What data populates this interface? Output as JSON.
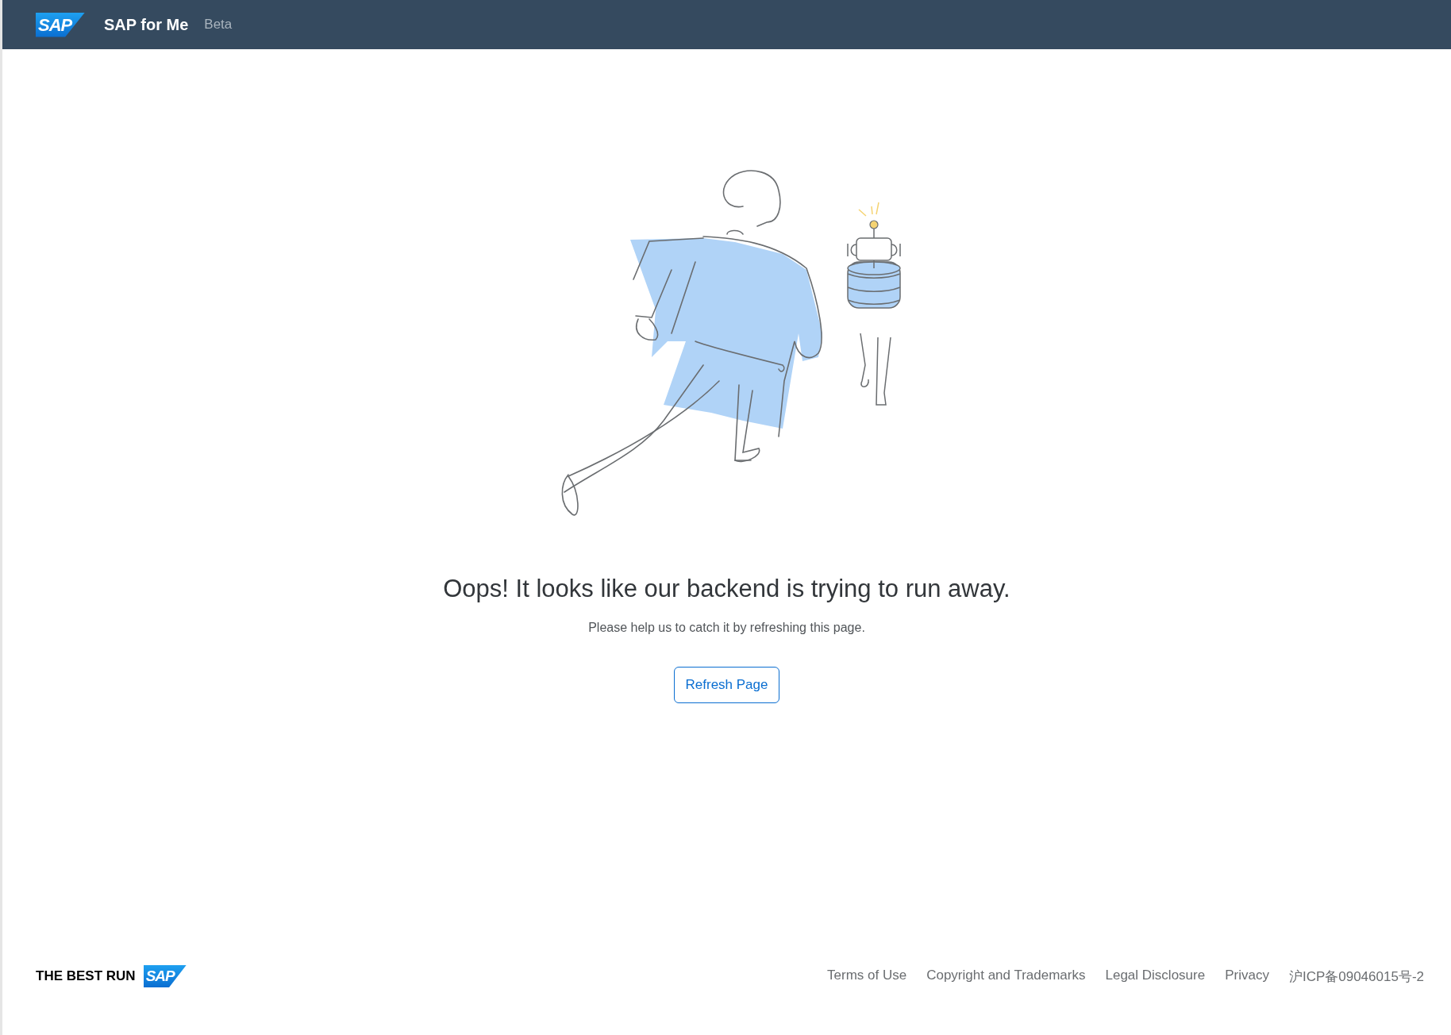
{
  "header": {
    "logo": "SAP",
    "title": "SAP for Me",
    "badge": "Beta"
  },
  "message": {
    "heading": "Oops! It looks like our backend is trying to run away.",
    "text": "Please help us to catch it by refreshing this page.",
    "button": "Refresh Page"
  },
  "footer": {
    "tagline": "THE BEST RUN",
    "logo": "SAP",
    "links": [
      "Terms of Use",
      "Copyright and Trademarks",
      "Legal Disclosure",
      "Privacy",
      "沪ICP备09046015号-2"
    ]
  }
}
